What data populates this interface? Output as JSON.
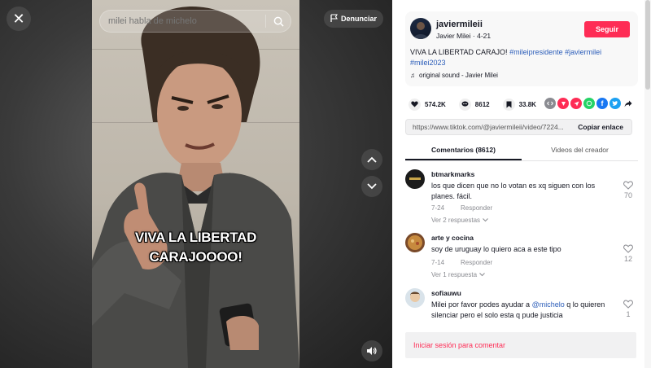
{
  "video": {
    "search_placeholder": "milei habla de michelo",
    "report_label": "Denunciar",
    "caption_line1": "VIVA LA LIBERTAD",
    "caption_line2": "CARAJOOOO!"
  },
  "author": {
    "username": "javiermileii",
    "display_name": "Javier Milei",
    "date": "4-21",
    "follow_label": "Seguir",
    "description_text": "VIVA LA LIBERTAD CARAJO!",
    "hashtags": [
      "#mileipresidente",
      "#javiermilei",
      "#milei2023"
    ],
    "sound": "original sound - Javier Milei"
  },
  "stats": {
    "likes": "574.2K",
    "comments": "8612",
    "saves": "33.8K"
  },
  "share_icons": [
    "embed-icon",
    "friends-icon",
    "send-icon",
    "whatsapp-icon",
    "facebook-icon",
    "twitter-icon",
    "share-arrow-icon"
  ],
  "link": {
    "url": "https://www.tiktok.com/@javiermileii/video/7224...",
    "copy_label": "Copiar enlace"
  },
  "tabs": {
    "comments": "Comentarios (8612)",
    "creator_videos": "Videos del creador"
  },
  "comments": [
    {
      "user": "btmarkmarks",
      "text": "los que dicen que no lo votan es xq siguen con los planes. fácil.",
      "date": "7-24",
      "reply_label": "Responder",
      "replies_label": "Ver 2 respuestas",
      "likes": "70"
    },
    {
      "user": "arte y cocina",
      "text": "soy de uruguay lo quiero aca a este tipo",
      "date": "7-14",
      "reply_label": "Responder",
      "replies_label": "Ver 1 respuesta",
      "likes": "12"
    },
    {
      "user": "sofiauwu",
      "text_before": "Milei por favor podes ayudar a ",
      "mention": "@michelo",
      "text_after": " q lo quieren silenciar pero el solo esta q pude justicia",
      "likes": "1"
    }
  ],
  "login_prompt": "Iniciar sesión para comentar",
  "colors": {
    "accent": "#fe2c55",
    "hashtag": "#2b5db9",
    "muted": "#8a8b91"
  }
}
